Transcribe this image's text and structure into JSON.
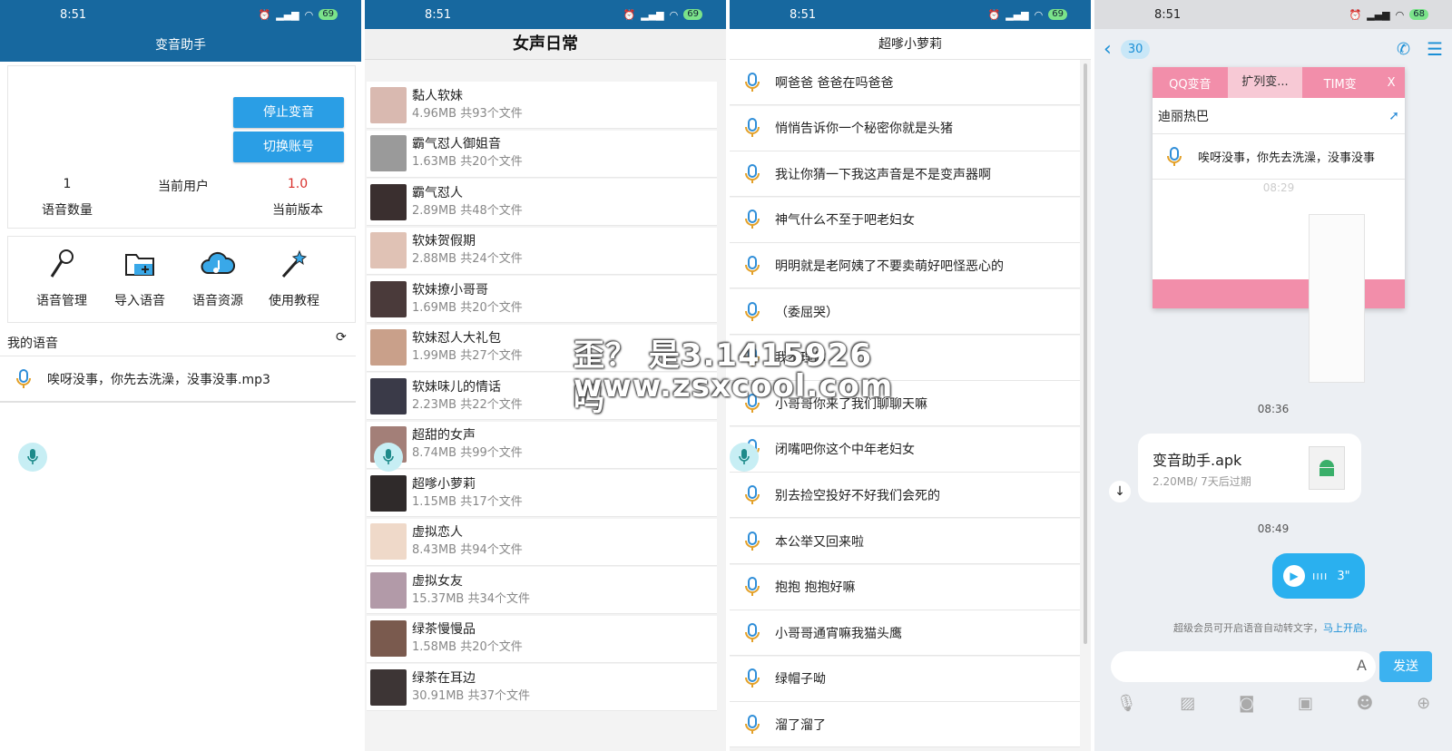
{
  "status": {
    "time": "8:51",
    "battery1": "69",
    "battery4": "68"
  },
  "panel1": {
    "title": "变音助手",
    "stop_button": "停止变音",
    "switch_button": "切换账号",
    "stats": [
      {
        "value": "1",
        "label": "语音数量"
      },
      {
        "value": "当前用户",
        "label": ""
      },
      {
        "value": "1.0",
        "label": "当前版本"
      }
    ],
    "tools": [
      {
        "label": "语音管理",
        "icon": "microphone-icon"
      },
      {
        "label": "导入语音",
        "icon": "folder-add-icon"
      },
      {
        "label": "语音资源",
        "icon": "cloud-music-icon"
      },
      {
        "label": "使用教程",
        "icon": "magic-wand-icon"
      }
    ],
    "my_voice_label": "我的语音",
    "voice_file": "唉呀没事，你先去洗澡，没事没事.mp3",
    "accent_color": "#2a9ee5",
    "version_color": "#d9302c"
  },
  "panel2": {
    "title": "女声日常",
    "items": [
      {
        "name": "黏人软妹",
        "size": "4.96MB  共93个文件"
      },
      {
        "name": "霸气怼人御姐音",
        "size": "1.63MB  共20个文件"
      },
      {
        "name": "霸气怼人",
        "size": "2.89MB  共48个文件"
      },
      {
        "name": "软妹贺假期",
        "size": "2.88MB  共24个文件"
      },
      {
        "name": "软妹撩小哥哥",
        "size": "1.69MB  共20个文件"
      },
      {
        "name": "软妹怼人大礼包",
        "size": "1.99MB  共27个文件"
      },
      {
        "name": "软妹味儿的情话",
        "size": "2.23MB  共22个文件"
      },
      {
        "name": "超甜的女声",
        "size": "8.74MB  共99个文件"
      },
      {
        "name": "超嗲小萝莉",
        "size": "1.15MB  共17个文件"
      },
      {
        "name": "虚拟恋人",
        "size": "8.43MB  共94个文件"
      },
      {
        "name": "虚拟女友",
        "size": "15.37MB  共34个文件"
      },
      {
        "name": "绿茶慢慢品",
        "size": "1.58MB  共20个文件"
      },
      {
        "name": "绿茶在耳边",
        "size": "30.91MB  共37个文件"
      }
    ]
  },
  "panel3": {
    "title": "超嗲小萝莉",
    "items": [
      "啊爸爸 爸爸在吗爸爸",
      "悄悄告诉你一个秘密你就是头猪",
      "我让你猜一下我这声音是不是变声器啊",
      "神气什么不至于吧老妇女",
      "明明就是老阿姨了不要卖萌好吧怪恶心的",
      "（委屈哭）",
      "我不理你",
      "小哥哥你来了我们聊聊天嘛",
      "闭嘴吧你这个中年老妇女",
      "别去捡空投好不好我们会死的",
      "本公举又回来啦",
      "抱抱 抱抱好嘛",
      "小哥哥通宵嘛我猫头鹰",
      "绿帽子呦",
      "溜了溜了"
    ]
  },
  "panel4": {
    "unread_count": "30",
    "popup_tabs": [
      "QQ变音",
      "扩列变...",
      "TIM变",
      "X"
    ],
    "popup_title": "迪丽热巴",
    "popup_item": "唉呀没事，你先去洗澡，没事没事",
    "faint_time": "08:29",
    "time1": "08:36",
    "file_name": "变音助手.apk",
    "file_meta": "2.20MB/ 7天后过期",
    "time2": "08:49",
    "voice_duration": "3\"",
    "hint_text": "超级会员可开启语音自动转文字，",
    "hint_link": "马上开启。",
    "send_button": "发送"
  },
  "watermark": {
    "line1": "歪？ 是3.1415926吗",
    "line2": "www.zsxcool.com"
  }
}
